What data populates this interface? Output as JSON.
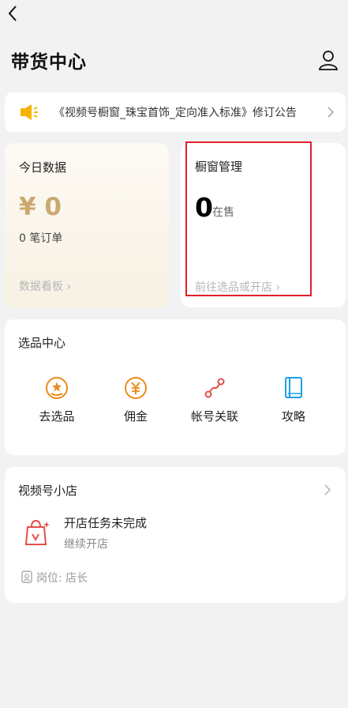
{
  "header": {
    "title": "带货中心"
  },
  "notice": {
    "text": "《视频号橱窗_珠宝首饰_定向准入标准》修订公告"
  },
  "today": {
    "title": "今日数据",
    "amount": "¥ 0",
    "orders": "0 笔订单",
    "board_link": "数据看板 ›"
  },
  "window": {
    "title": "橱窗管理",
    "count": "0",
    "count_label": "在售",
    "link": "前往选品或开店 ›"
  },
  "select_center": {
    "title": "选品中心",
    "tools": [
      {
        "label": "去选品",
        "icon": "select-product-icon"
      },
      {
        "label": "佣金",
        "icon": "commission-yen-icon"
      },
      {
        "label": "帐号关联",
        "icon": "account-link-icon"
      },
      {
        "label": "攻略",
        "icon": "guide-book-icon"
      }
    ]
  },
  "shop": {
    "title": "视频号小店",
    "task_title": "开店任务未完成",
    "task_subtitle": "继续开店",
    "role": "岗位: 店长"
  },
  "colors": {
    "accent_gold": "#c9a971",
    "icon_orange": "#ec8a1c",
    "icon_red": "#e2504a",
    "icon_blue": "#1aa1e6",
    "highlight_red": "#e0202a"
  }
}
